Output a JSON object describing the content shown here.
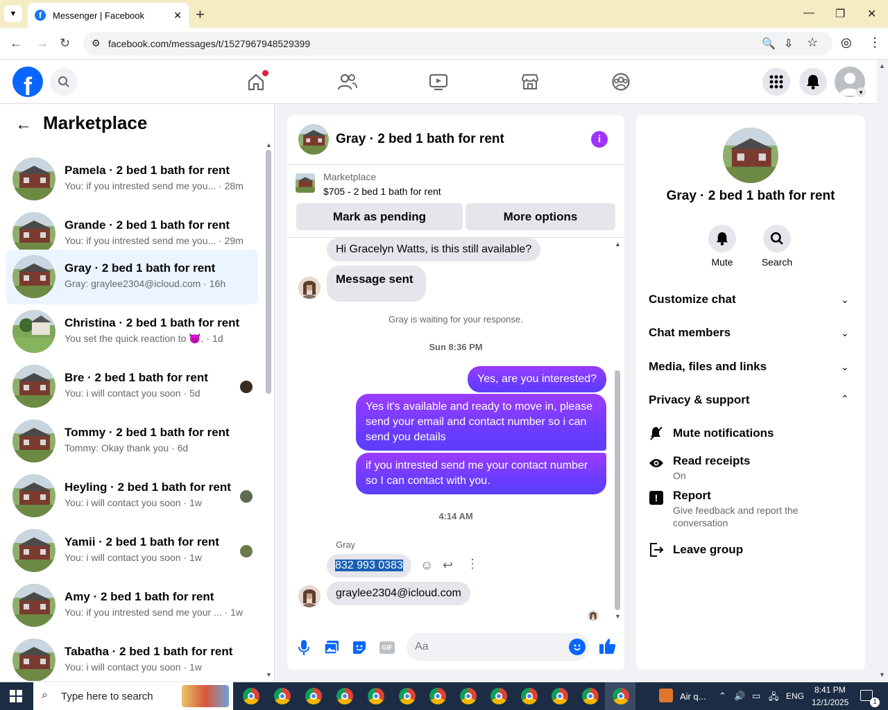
{
  "browser": {
    "tab_title": "Messenger | Facebook",
    "url": "facebook.com/messages/t/1527967948529399"
  },
  "sidebar": {
    "title": "Marketplace",
    "conversations": [
      {
        "name": "Pamela · 2 bed 1 bath for rent",
        "preview": "You: if you intrested send me you... · 28m"
      },
      {
        "name": "Grande · 2 bed 1 bath for rent",
        "preview": "You: if you intrested send me you... · 29m"
      },
      {
        "name": "Gray · 2 bed 1 bath for rent",
        "preview": "Gray: graylee2304@icloud.com · 16h"
      },
      {
        "name": "Christina · 2 bed 1 bath for rent",
        "preview": "You set the quick reaction to 😈. · 1d"
      },
      {
        "name": "Bre · 2 bed 1 bath for rent",
        "preview": "You: i will contact you soon · 5d"
      },
      {
        "name": "Tommy · 2 bed 1 bath for rent",
        "preview": "Tommy: Okay thank you · 6d"
      },
      {
        "name": "Heyling · 2 bed 1 bath for rent",
        "preview": "You: i will contact you soon · 1w"
      },
      {
        "name": "Yamii · 2 bed 1 bath for rent",
        "preview": "You: i will contact you soon · 1w"
      },
      {
        "name": "Amy · 2 bed 1 bath for rent",
        "preview": "You: if you intrested send me your ... · 1w"
      },
      {
        "name": "Tabatha · 2 bed 1 bath for rent",
        "preview": "You: i will contact you soon · 1w"
      }
    ]
  },
  "chat": {
    "title": "Gray · 2 bed 1 bath for rent",
    "listing_label": "Marketplace",
    "listing_price": "$705 - 2 bed 1 bath for rent",
    "mark_pending": "Mark as pending",
    "more_options": "More options",
    "messages": {
      "m1": "Hi Gracelyn Watts, is this still available?",
      "m2": "Message sent",
      "waiting": "Gray is waiting for your response.",
      "ts1": "Sun 8:36 PM",
      "m3": "Yes, are you interested?",
      "m4": "Yes it's available and ready to move in, please send your email and contact number so i can send you details",
      "m5": "if you intrested send me your contact number so I can contact with you.",
      "ts2": "4:14 AM",
      "sender": "Gray",
      "m6": "832 993 0383",
      "m7": "graylee2304@icloud.com"
    },
    "composer_placeholder": "Aa"
  },
  "right_panel": {
    "title": "Gray · 2 bed 1 bath for rent",
    "mute_label": "Mute",
    "search_label": "Search",
    "sections": {
      "customize": "Customize chat",
      "members": "Chat members",
      "media": "Media, files and links",
      "privacy": "Privacy & support"
    },
    "items": {
      "mute_notifications": "Mute notifications",
      "read_receipts": "Read receipts",
      "read_receipts_state": "On",
      "report": "Report",
      "report_desc": "Give feedback and report the conversation",
      "leave": "Leave group"
    }
  },
  "taskbar": {
    "search_placeholder": "Type here to search",
    "weather": "Air q...",
    "lang": "ENG",
    "time": "8:41 PM",
    "date": "12/1/2025",
    "notif_count": "1"
  },
  "colors": {
    "brand": "#0866ff",
    "outgoing_bubble": "#6e3cff",
    "info_accent": "#a033ff"
  }
}
